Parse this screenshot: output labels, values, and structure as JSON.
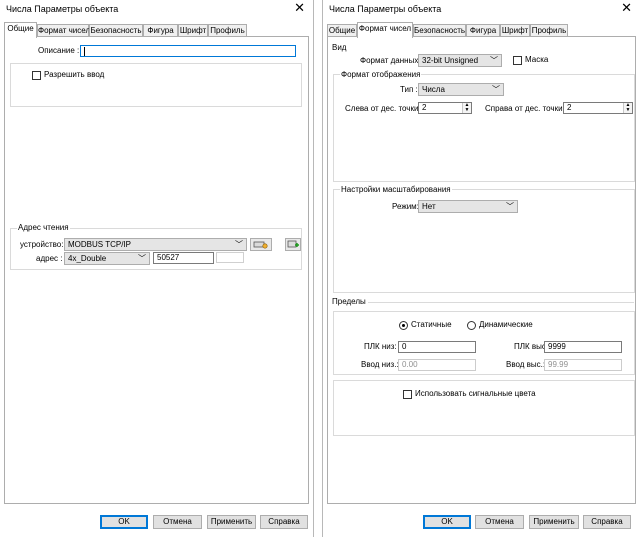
{
  "left": {
    "title": "Числа Параметры объекта",
    "close": "✕",
    "tabs": [
      "Общие",
      "Формат чисел",
      "Безопасность",
      "Фигура",
      "Шрифт",
      "Профиль"
    ],
    "description": {
      "label": "Описание :",
      "value": ""
    },
    "allow_input": {
      "label": "Разрешить ввод",
      "checked": false
    },
    "read_address": {
      "title": "Адрес чтения",
      "device_label": "устройство:",
      "device_value": "MODBUS TCP/IP",
      "address_label": "адрес :",
      "address_type": "4x_Double",
      "address_value": "50527"
    },
    "buttons": {
      "ok": "OK",
      "cancel": "Отмена",
      "apply": "Применить",
      "help": "Справка"
    }
  },
  "right": {
    "title": "Числа Параметры объекта",
    "close": "✕",
    "tabs": [
      "Общие",
      "Формат чисел",
      "Безопасность",
      "Фигура",
      "Шрифт",
      "Профиль"
    ],
    "view": {
      "title": "Вид",
      "data_format_label": "Формат данных:",
      "data_format_value": "32-bit Unsigned",
      "mask_label": "Маска"
    },
    "display_format": {
      "title": "Формат отображения",
      "type_label": "Тип :",
      "type_value": "Числа",
      "left_label": "Слева от дес. точки :",
      "left_value": "2",
      "right_label": "Справа от дес. точки :",
      "right_value": "2"
    },
    "scaling": {
      "title": "Настройки масштабирования",
      "mode_label": "Режим:",
      "mode_value": "Нет"
    },
    "limits": {
      "title": "Пределы",
      "static_label": "Статичные",
      "dynamic_label": "Динамические",
      "selected": "static",
      "plc_low_label": "ПЛК низ:",
      "plc_low_value": "0",
      "plc_high_label": "ПЛК выс:",
      "plc_high_value": "9999",
      "input_low_label": "Ввод низ.:",
      "input_low_value": "0.00",
      "input_high_label": "Ввод выс.:",
      "input_high_value": "99.99"
    },
    "signal_colors_label": "Использовать сигнальные цвета",
    "buttons": {
      "ok": "OK",
      "cancel": "Отмена",
      "apply": "Применить",
      "help": "Справка"
    }
  },
  "colors": {
    "accent": "#0078d7",
    "button_face": "#e1e1e1",
    "border": "#adadad"
  }
}
